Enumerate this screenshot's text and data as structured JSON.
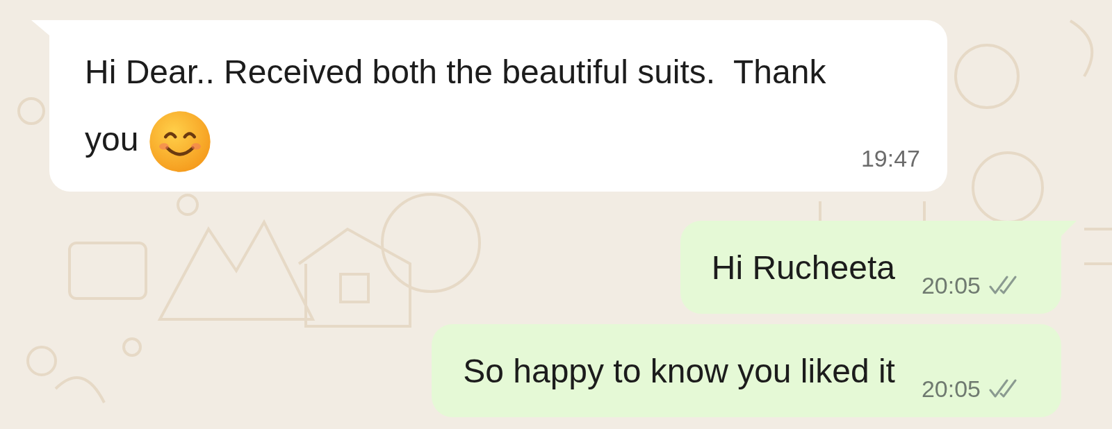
{
  "messages": [
    {
      "kind": "incoming",
      "text": "Hi Dear.. Received both the beautiful suits.  Thank you",
      "trailing_emoji": true,
      "time": "19:47",
      "tail": true
    },
    {
      "kind": "outgoing",
      "text": "Hi Rucheeta",
      "time": "20:05",
      "read": false,
      "tail": true
    },
    {
      "kind": "outgoing",
      "text": "So happy to know you liked it",
      "time": "20:05",
      "read": false,
      "tail": false
    }
  ]
}
